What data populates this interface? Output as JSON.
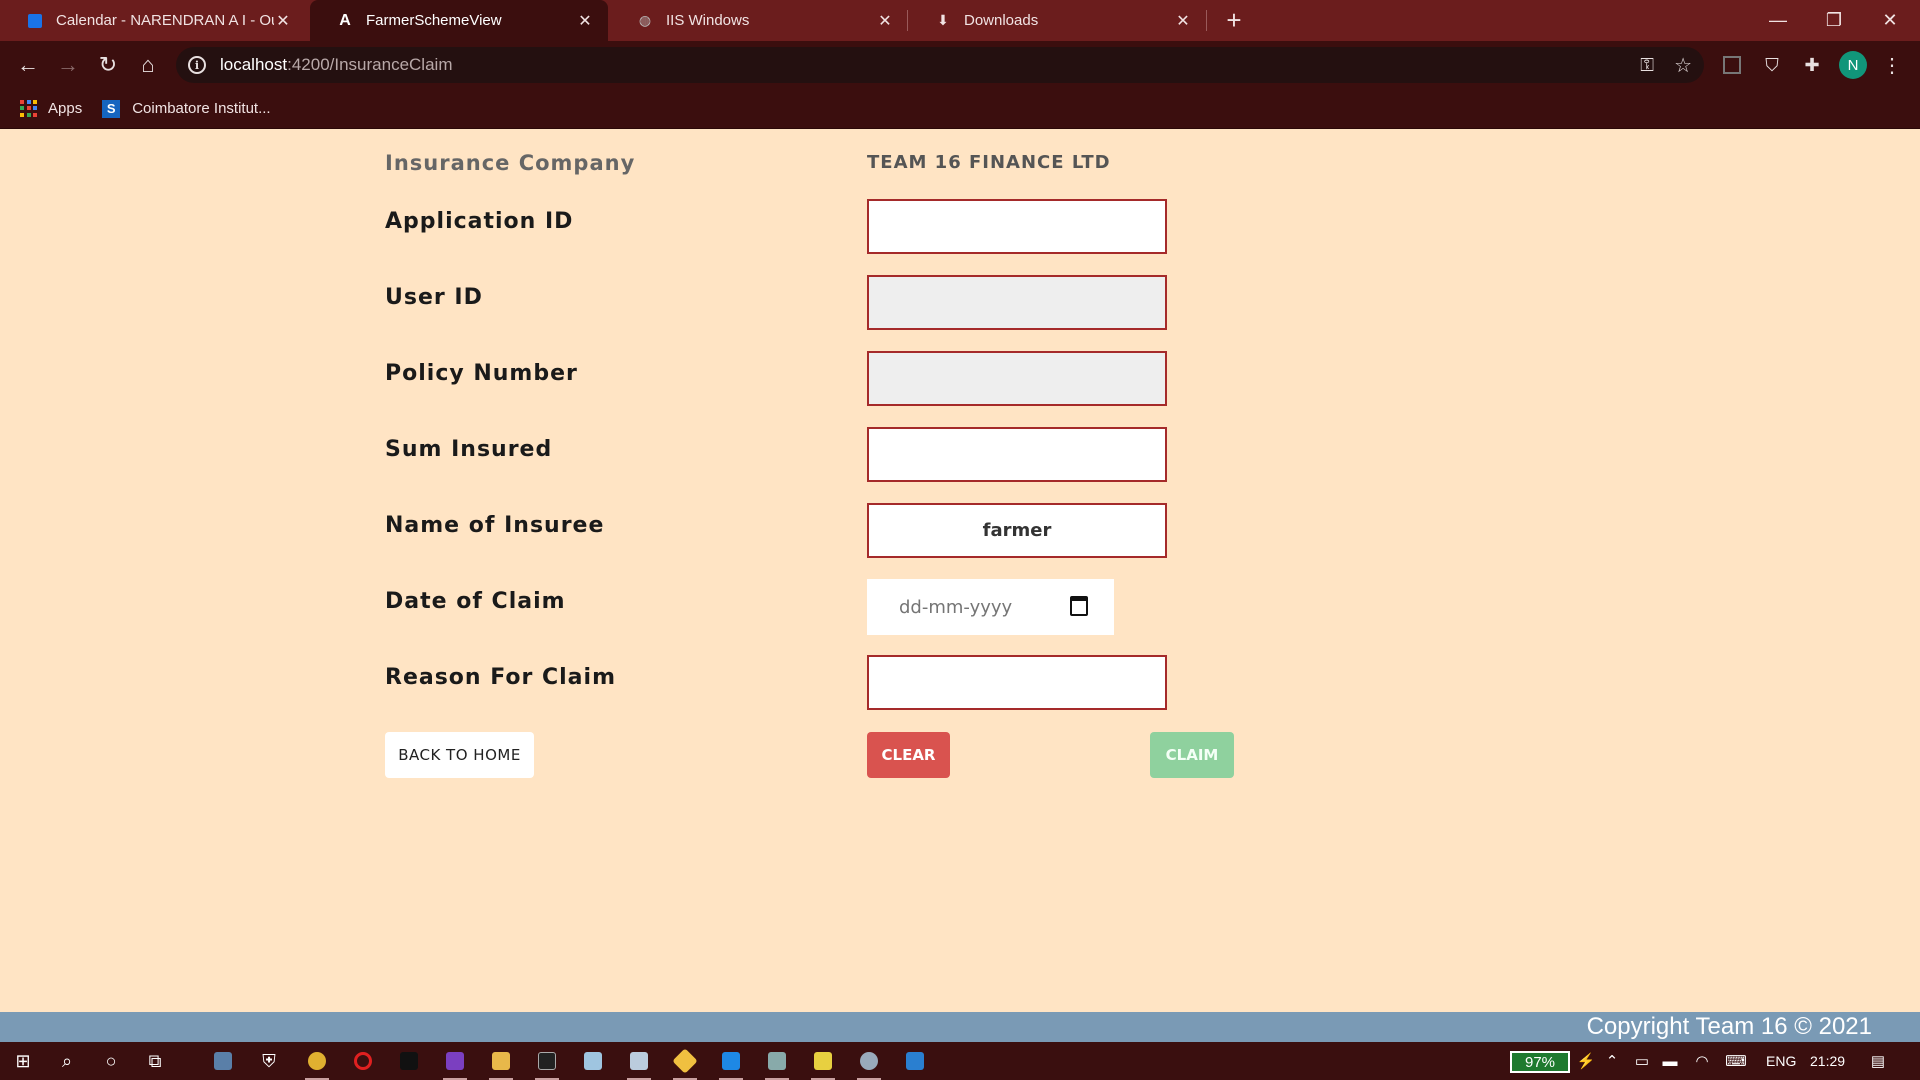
{
  "browser": {
    "tabs": [
      {
        "title": "Calendar - NARENDRAN A I - Ou",
        "icon": "outlook-icon"
      },
      {
        "title": "FarmerSchemeView",
        "icon": "angular-icon"
      },
      {
        "title": "IIS Windows",
        "icon": "globe-icon"
      },
      {
        "title": "Downloads",
        "icon": "download-icon"
      }
    ],
    "url_host": "localhost",
    "url_path": ":4200/InsuranceClaim",
    "profile_initial": "N",
    "bookmarks": [
      {
        "label": "Apps"
      },
      {
        "label": "Coimbatore Institut..."
      }
    ]
  },
  "form": {
    "company_label": "Insurance Company",
    "company_value": "TEAM 16 FINANCE LTD",
    "fields": {
      "application_id": {
        "label": "Application ID",
        "value": ""
      },
      "user_id": {
        "label": "User ID",
        "value": ""
      },
      "policy_number": {
        "label": "Policy Number",
        "value": ""
      },
      "sum_insured": {
        "label": "Sum Insured",
        "value": ""
      },
      "name_of_insuree": {
        "label": "Name of Insuree",
        "value": "farmer"
      },
      "date_of_claim": {
        "label": "Date of Claim",
        "placeholder": "dd-mm-yyyy"
      },
      "reason_for_claim": {
        "label": "Reason For Claim",
        "value": ""
      }
    },
    "buttons": {
      "back_home": "BACK TO HOME",
      "clear": "CLEAR",
      "claim": "CLAIM"
    }
  },
  "footer": {
    "text": "Copyright Team 16 © 2021"
  },
  "taskbar": {
    "battery": "97%",
    "language": "ENG",
    "time": "21:29"
  },
  "colors": {
    "page_bg": "#ffe4c4",
    "field_border": "#a52a2a",
    "clear_button": "#d9534f",
    "claim_button": "#8fd19e",
    "footer_bg": "#7a9ab5",
    "chrome_frame": "#6b1d1d"
  }
}
